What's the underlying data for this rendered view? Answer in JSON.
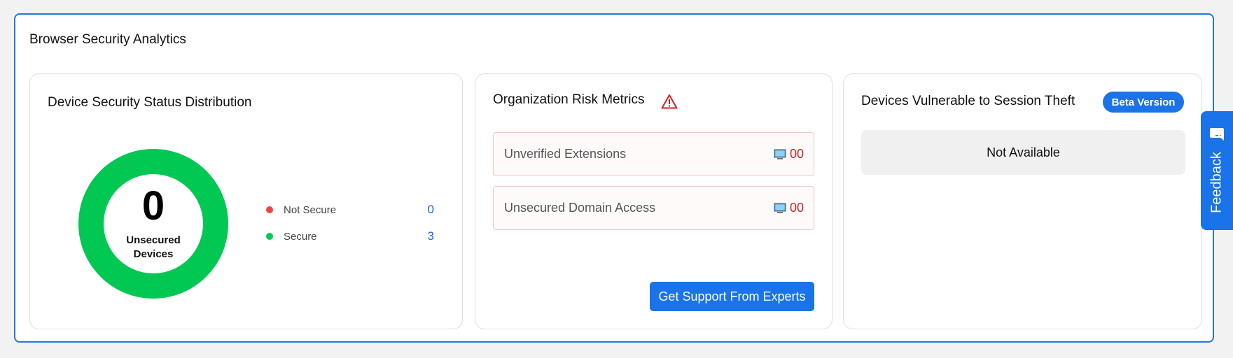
{
  "panel": {
    "title": "Browser Security Analytics"
  },
  "distribution": {
    "title": "Device Security Status Distribution",
    "donut_value": "0",
    "donut_label": "Unsecured Devices",
    "legend": [
      {
        "label": "Not Secure",
        "value": "0",
        "color": "#f04444"
      },
      {
        "label": "Secure",
        "value": "3",
        "color": "#00c853"
      }
    ]
  },
  "risk": {
    "title": "Organization Risk Metrics",
    "icon": "warning-triangle-icon",
    "metrics": [
      {
        "label": "Unverified Extensions",
        "value": "00",
        "icon": "computer-icon"
      },
      {
        "label": "Unsecured Domain Access",
        "value": "00",
        "icon": "computer-icon"
      }
    ],
    "support_label": "Get Support From Experts"
  },
  "session": {
    "title": "Devices Vulnerable to Session Theft",
    "badge": "Beta Version",
    "status": "Not Available"
  },
  "feedback": {
    "label": "Feedback",
    "icon": "chat-bubble-icon"
  },
  "colors": {
    "accent": "#1a73e8",
    "secure": "#00c853",
    "not_secure": "#f04444",
    "risk_value": "#d11f1f"
  }
}
